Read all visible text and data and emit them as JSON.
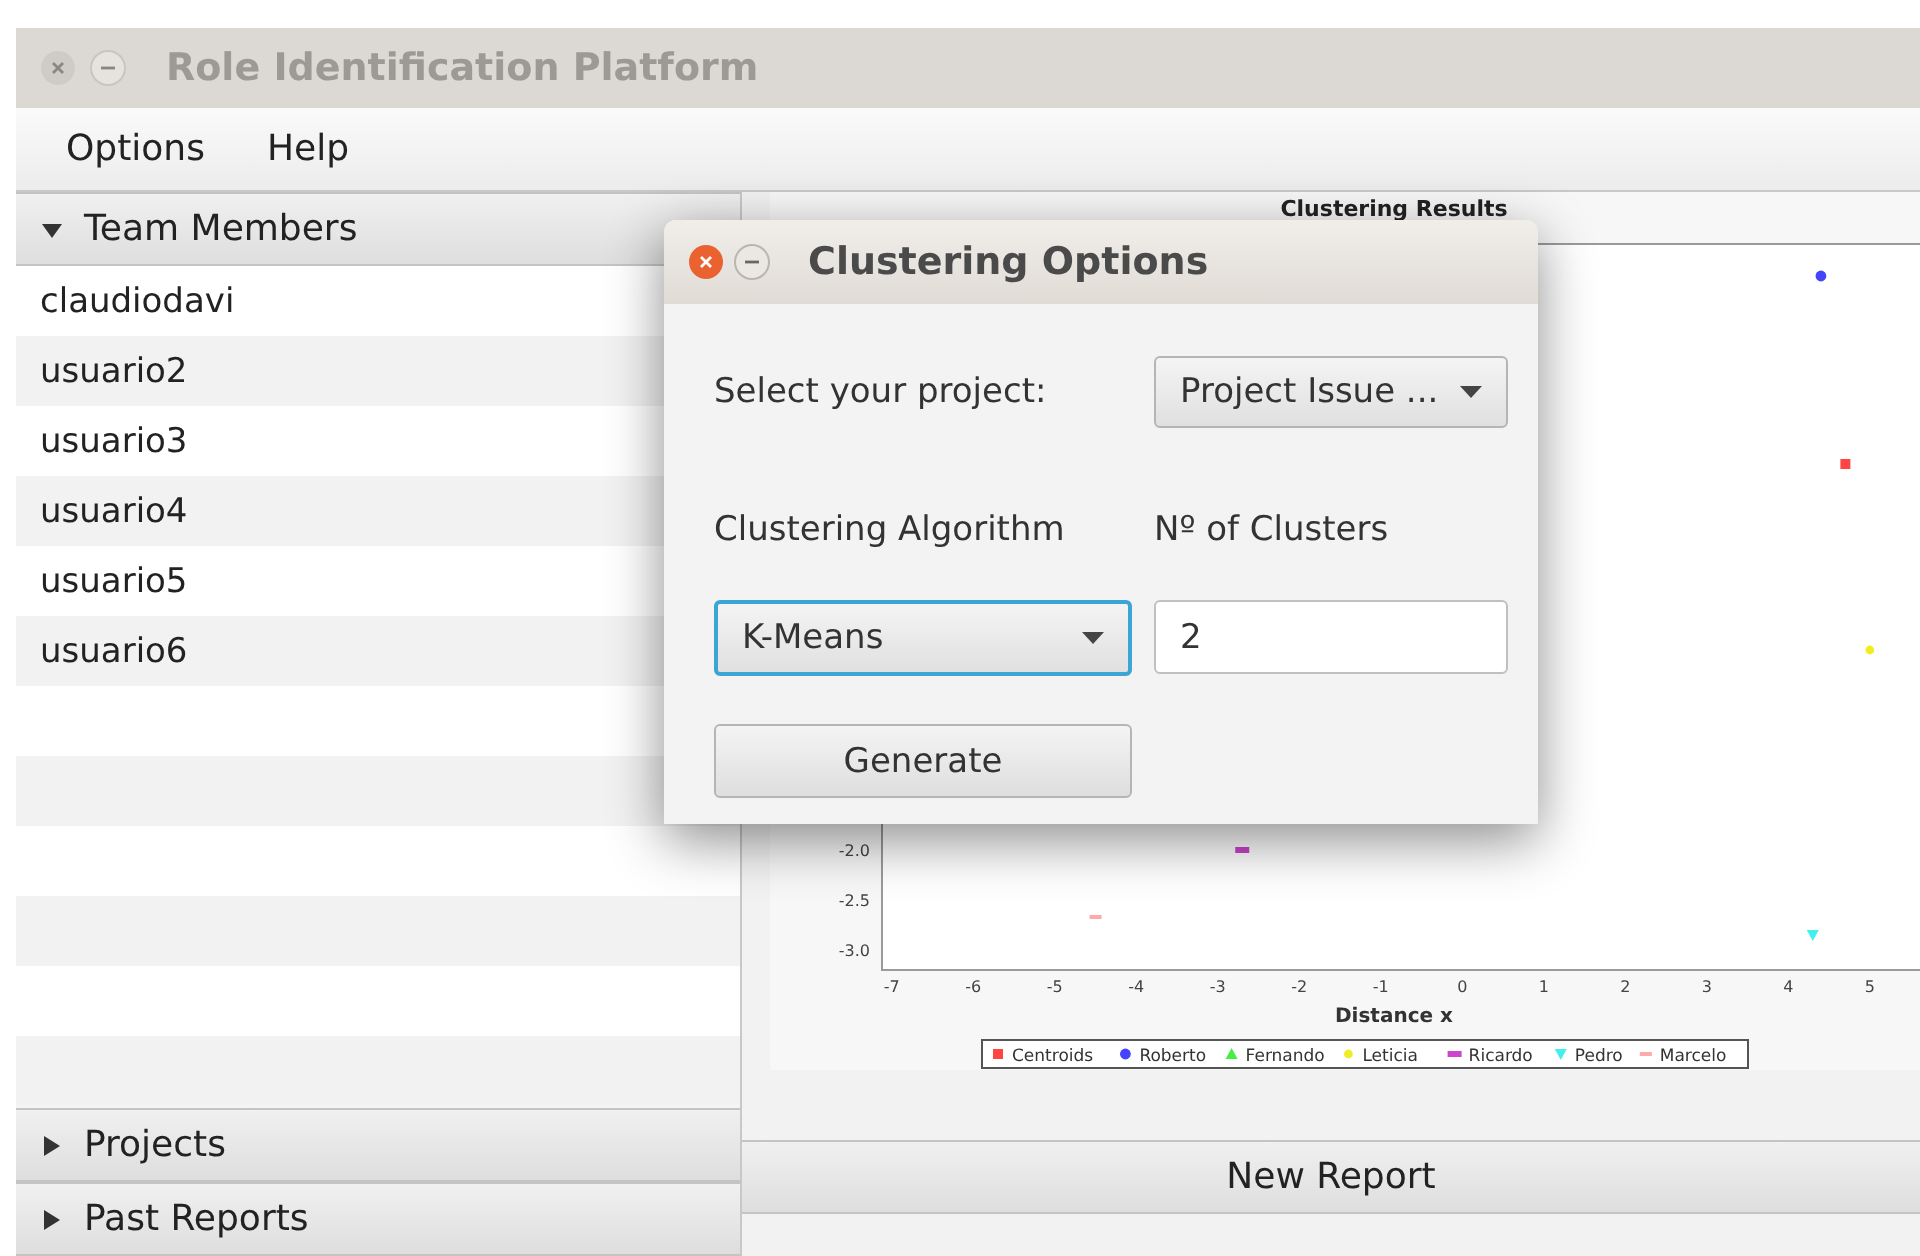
{
  "window": {
    "title": "Role Identification Platform"
  },
  "menu": [
    "Options",
    "Help"
  ],
  "sidebar": {
    "sections": [
      {
        "label": "Team Members",
        "expanded": true,
        "items": [
          "claudiodavi",
          "usuario2",
          "usuario3",
          "usuario4",
          "usuario5",
          "usuario6"
        ]
      },
      {
        "label": "Projects",
        "expanded": false
      },
      {
        "label": "Past Reports",
        "expanded": false
      }
    ]
  },
  "results": {
    "title": "Clustering Results",
    "chart_data": {
      "type": "scatter",
      "xlabel": "Distance x",
      "xlim": [
        -7.12,
        5.64
      ],
      "ylim": [
        -3.2,
        4.06
      ],
      "legend": true,
      "xticks": [
        {
          "value": -7,
          "label": "-7"
        },
        {
          "value": -6,
          "label": "-6"
        },
        {
          "value": -5,
          "label": "-5"
        },
        {
          "value": -4,
          "label": "-4"
        },
        {
          "value": -3,
          "label": "-3"
        },
        {
          "value": -2,
          "label": "-2"
        },
        {
          "value": -1,
          "label": "-1"
        },
        {
          "value": 0,
          "label": "0"
        },
        {
          "value": 1,
          "label": "1"
        },
        {
          "value": 2,
          "label": "2"
        },
        {
          "value": 3,
          "label": "3"
        },
        {
          "value": 4,
          "label": "4"
        },
        {
          "value": 5,
          "label": "5"
        }
      ],
      "yticks": [
        {
          "value": -2,
          "label": "-2.0"
        },
        {
          "value": -2.5,
          "label": "-2.5"
        },
        {
          "value": -3,
          "label": "-3.0"
        }
      ],
      "series": [
        {
          "name": "Centroids",
          "color": "#ff4444",
          "x": [
            4.7
          ],
          "values": [
            1.86
          ]
        },
        {
          "name": "Roberto",
          "color": "#4444ff",
          "x": [
            4.4
          ],
          "values": [
            3.74
          ]
        },
        {
          "name": "Fernando",
          "color": "#44ee44"
        },
        {
          "name": "Leticia",
          "color": "#eeee22",
          "x": [
            5.0
          ],
          "values": [
            0.0
          ]
        },
        {
          "name": "Ricardo",
          "color": "#cc44cc",
          "x": [
            -2.7
          ],
          "values": [
            -2.0
          ]
        },
        {
          "name": "Pedro",
          "color": "#44eeee",
          "x": [
            4.3
          ],
          "values": [
            -2.85
          ]
        },
        {
          "name": "Marcelo",
          "color": "#ffaaaa",
          "x": [
            -4.5
          ],
          "values": [
            -2.67
          ]
        }
      ]
    }
  },
  "report_button": "New Report",
  "dialog": {
    "title": "Clustering Options",
    "project_label": "Select your project:",
    "project_value": "Project Issue ...",
    "algorithm_label": "Clustering Algorithm",
    "algorithm_value": "K-Means",
    "algorithm_focused": true,
    "clusters_label": "Nº of Clusters",
    "clusters_value": "2",
    "button": "Generate"
  }
}
